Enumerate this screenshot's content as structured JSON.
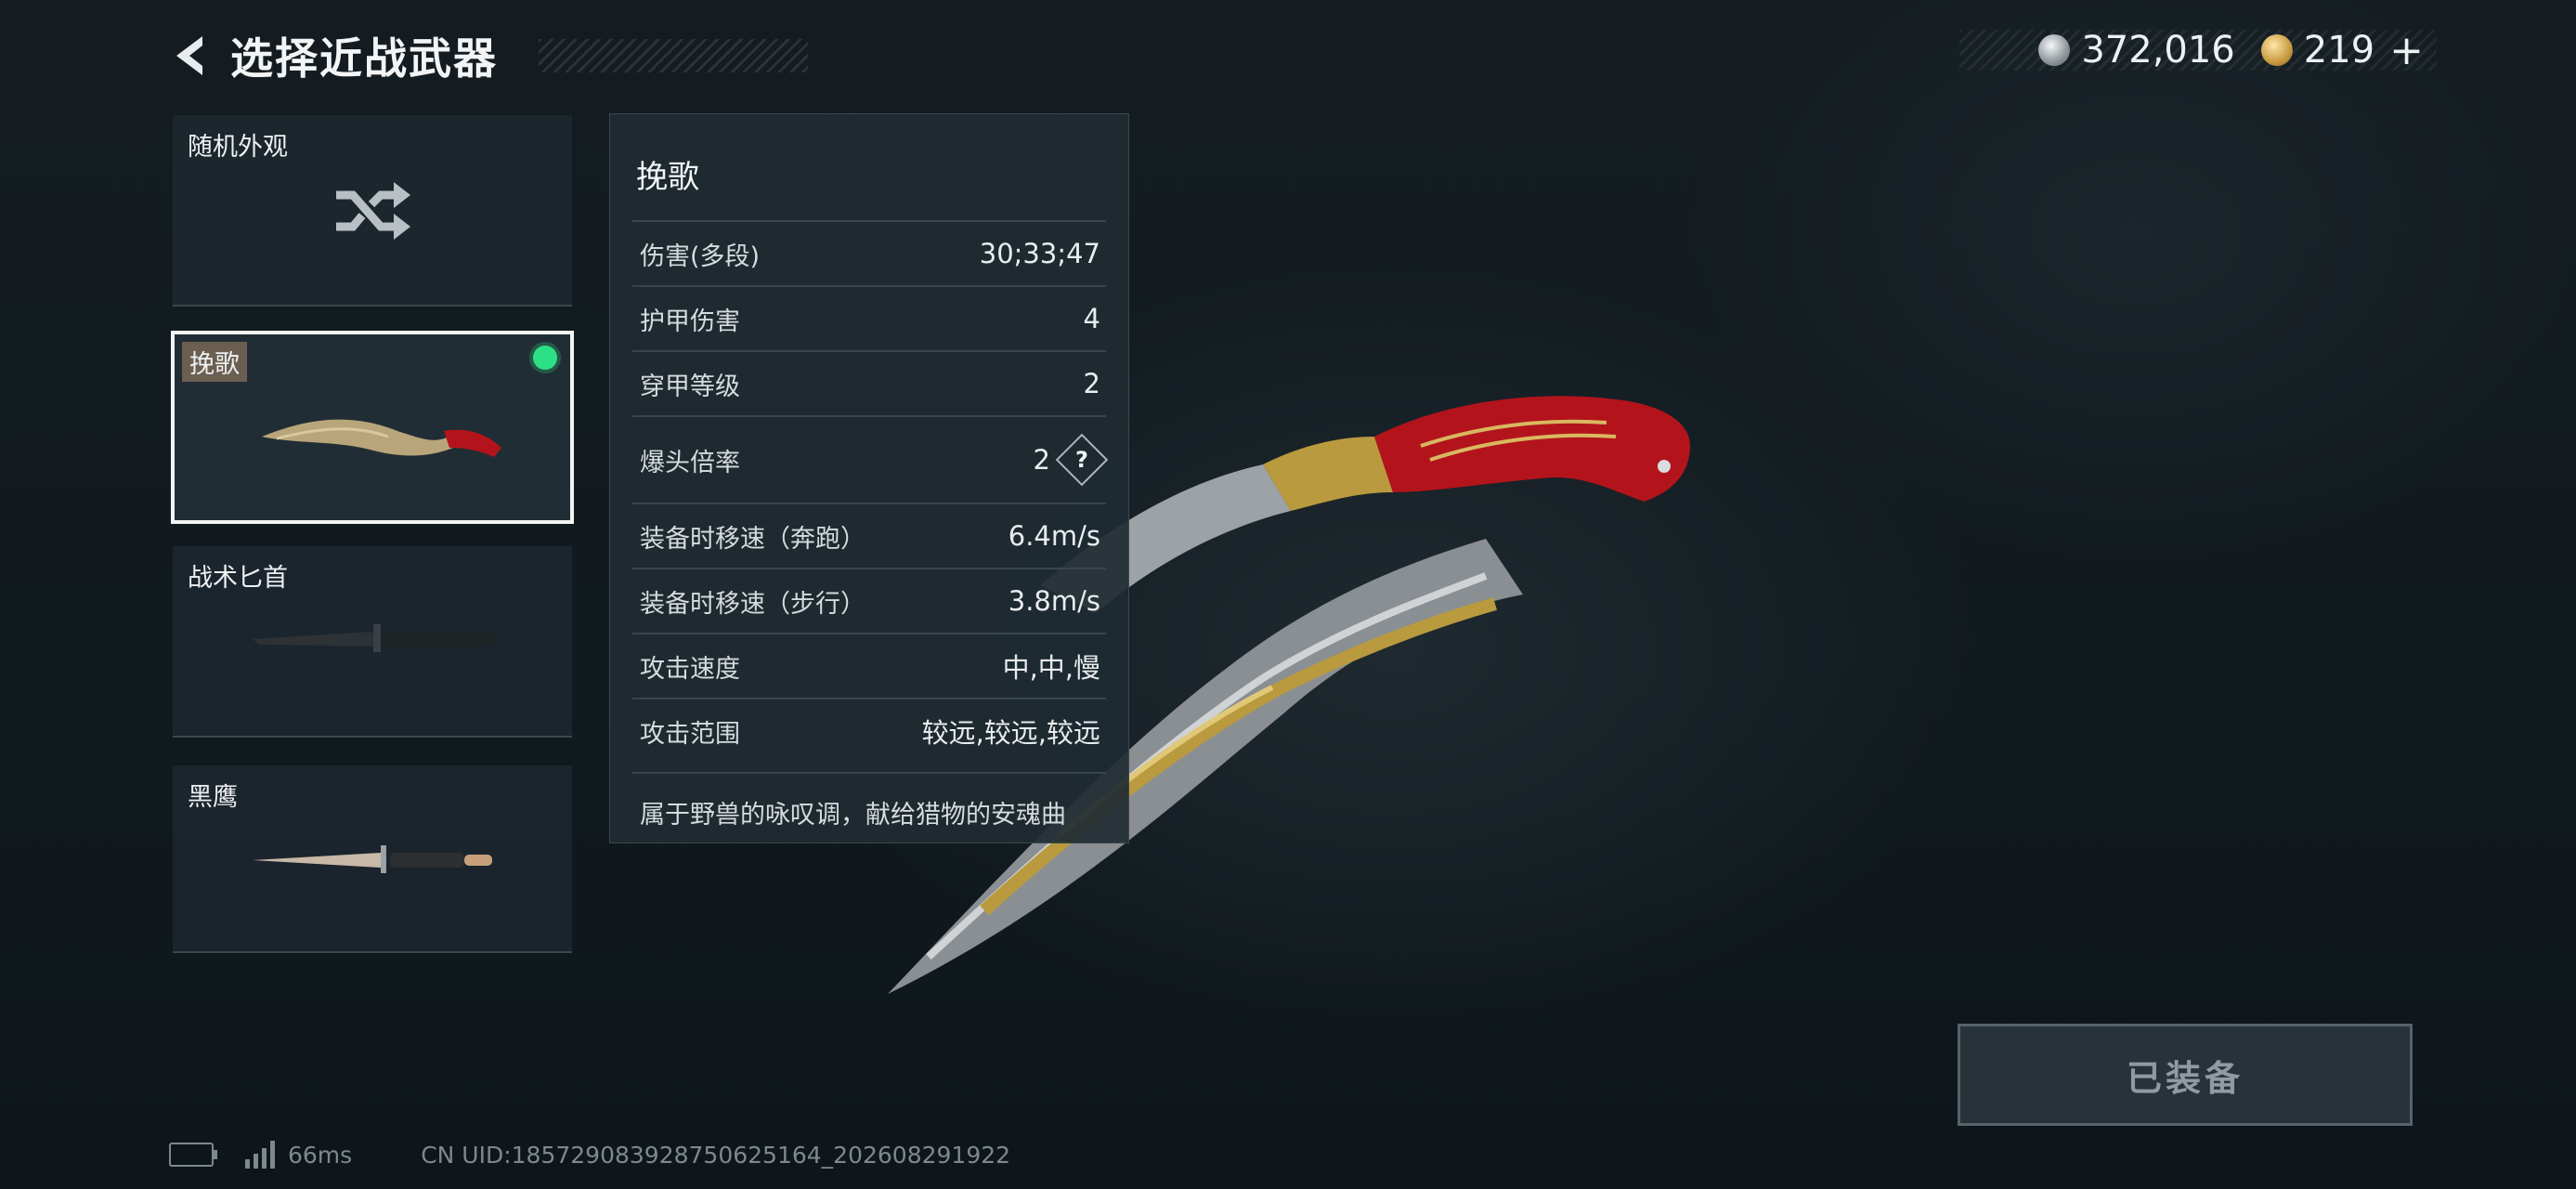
{
  "header": {
    "title": "选择近战武器"
  },
  "currency": {
    "silver": "372,016",
    "gold": "219",
    "plus": "+"
  },
  "weapon_list": [
    {
      "label": "随机外观",
      "type": "random"
    },
    {
      "label": "挽歌",
      "selected": true,
      "equipped": true
    },
    {
      "label": "战术匕首"
    },
    {
      "label": "黑鹰"
    }
  ],
  "details": {
    "name": "挽歌",
    "stats": [
      {
        "key": "伤害(多段)",
        "value": "30;33;47"
      },
      {
        "key": "护甲伤害",
        "value": "4"
      },
      {
        "key": "穿甲等级",
        "value": "2"
      },
      {
        "key": "爆头倍率",
        "value": "2",
        "help": "?"
      },
      {
        "key": "装备时移速（奔跑）",
        "value": "6.4m/s"
      },
      {
        "key": "装备时移速（步行）",
        "value": "3.8m/s"
      },
      {
        "key": "攻击速度",
        "value": "中,中,慢"
      },
      {
        "key": "攻击范围",
        "value": "较远,较远,较远"
      }
    ],
    "description": "属于野兽的咏叹调，献给猎物的安魂曲"
  },
  "equip_button": {
    "label": "已装备"
  },
  "footer": {
    "ping": "66ms",
    "uid": "CN UID:185729083928750625164_202608291922"
  },
  "colors": {
    "equipped_dot": "#2ee085",
    "accent_red": "#b3141c"
  }
}
